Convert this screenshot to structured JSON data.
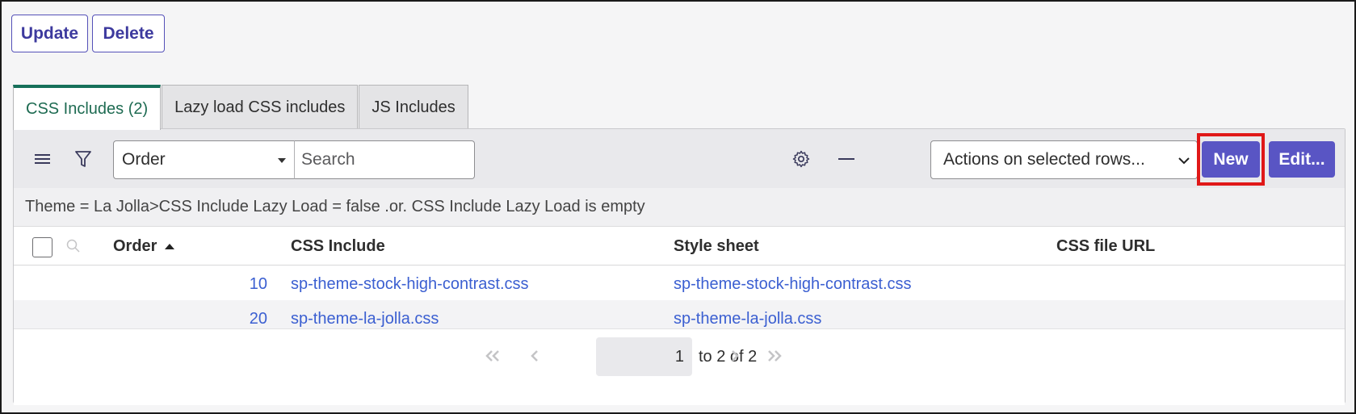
{
  "form_buttons": {
    "update": "Update",
    "delete": "Delete"
  },
  "tabs": [
    {
      "label": "CSS Includes (2)",
      "active": true
    },
    {
      "label": "Lazy load CSS includes",
      "active": false
    },
    {
      "label": "JS Includes",
      "active": false
    }
  ],
  "toolbar": {
    "search_field": "Order",
    "search_placeholder": "Search",
    "actions_label": "Actions on selected rows...",
    "new_label": "New",
    "edit_label": "Edit..."
  },
  "filter_text": "Theme = La Jolla>CSS Include Lazy Load = false .or. CSS Include Lazy Load is empty",
  "columns": {
    "order": "Order",
    "css_include": "CSS Include",
    "style_sheet": "Style sheet",
    "css_file_url": "CSS file URL"
  },
  "rows": [
    {
      "order": "10",
      "css_include": "sp-theme-stock-high-contrast.css",
      "style_sheet": "sp-theme-stock-high-contrast.css",
      "css_file_url": ""
    },
    {
      "order": "20",
      "css_include": "sp-theme-la-jolla.css",
      "style_sheet": "sp-theme-la-jolla.css",
      "css_file_url": ""
    }
  ],
  "pagination": {
    "current_page": "1",
    "range_text": "to 2 of 2"
  },
  "icons": [
    "list-menu-icon",
    "filter-icon",
    "gear-icon",
    "minus-icon",
    "search-icon",
    "sort-ascending-icon",
    "first-page-icon",
    "previous-page-icon",
    "next-page-icon",
    "last-page-icon"
  ],
  "colors": {
    "primary": "#5955c4",
    "active_tab": "#16705a",
    "link": "#3b5fd1",
    "highlight": "#e01818"
  }
}
